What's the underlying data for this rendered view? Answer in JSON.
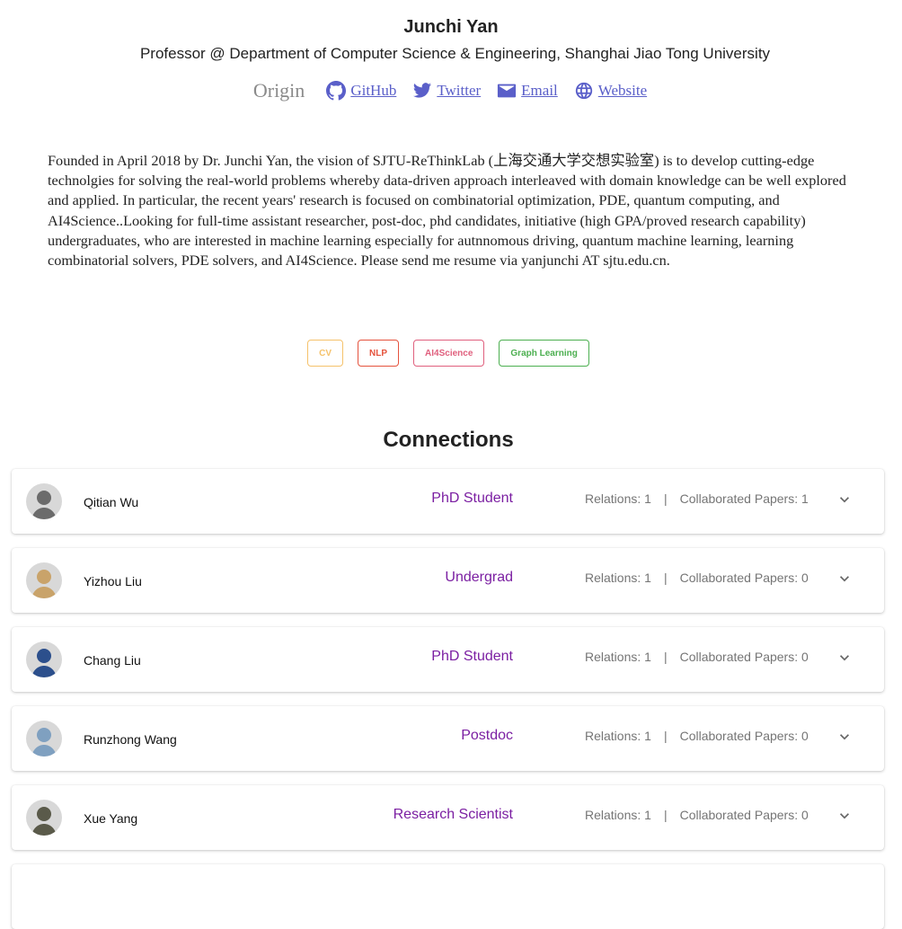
{
  "profile": {
    "name": "Junchi Yan",
    "subtitle": "Professor @ Department of Computer Science & Engineering, Shanghai Jiao Tong University",
    "origin_label": "Origin",
    "links": [
      {
        "label": "GitHub",
        "icon": "github-icon"
      },
      {
        "label": "Twitter",
        "icon": "twitter-icon"
      },
      {
        "label": "Email",
        "icon": "email-icon"
      },
      {
        "label": "Website",
        "icon": "globe-icon"
      }
    ],
    "bio": "Founded in April 2018 by Dr. Junchi Yan, the vision of SJTU-ReThinkLab (上海交通大学交想实验室) is to develop cutting-edge technolgies for solving the real-world problems whereby data-driven approach interleaved with domain knowledge can be well explored and applied. In particular, the recent years' research is focused on combinatorial optimization, PDE, quantum computing, and AI4Science..Looking for full-time assistant researcher, post-doc, phd candidates, initiative (high GPA/proved research capability) undergraduates, who are interested in machine learning especially for autnnomous driving, quantum machine learning, learning combinatorial solvers, PDE solvers, and AI4Science. Please send me resume via yanjunchi AT sjtu.edu.cn."
  },
  "tags": [
    {
      "label": "CV",
      "color": "#f5c26b"
    },
    {
      "label": "NLP",
      "color": "#e5533d"
    },
    {
      "label": "AI4Science",
      "color": "#e0607e"
    },
    {
      "label": "Graph Learning",
      "color": "#4caf50"
    }
  ],
  "connections_title": "Connections",
  "connections": [
    {
      "name": "Qitian Wu",
      "role": "PhD Student",
      "relations": "Relations: 1",
      "papers": "Collaborated Papers: 1",
      "avatar_color": "#6b6b6b"
    },
    {
      "name": "Yizhou Liu",
      "role": "Undergrad",
      "relations": "Relations: 1",
      "papers": "Collaborated Papers: 0",
      "avatar_color": "#c9a36a"
    },
    {
      "name": "Chang Liu",
      "role": "PhD Student",
      "relations": "Relations: 1",
      "papers": "Collaborated Papers: 0",
      "avatar_color": "#2c4f8c"
    },
    {
      "name": "Runzhong Wang",
      "role": "Postdoc",
      "relations": "Relations: 1",
      "papers": "Collaborated Papers: 0",
      "avatar_color": "#7fa0c0"
    },
    {
      "name": "Xue Yang",
      "role": "Research Scientist",
      "relations": "Relations: 1",
      "papers": "Collaborated Papers: 0",
      "avatar_color": "#5a5a4a"
    }
  ],
  "separator": "|"
}
